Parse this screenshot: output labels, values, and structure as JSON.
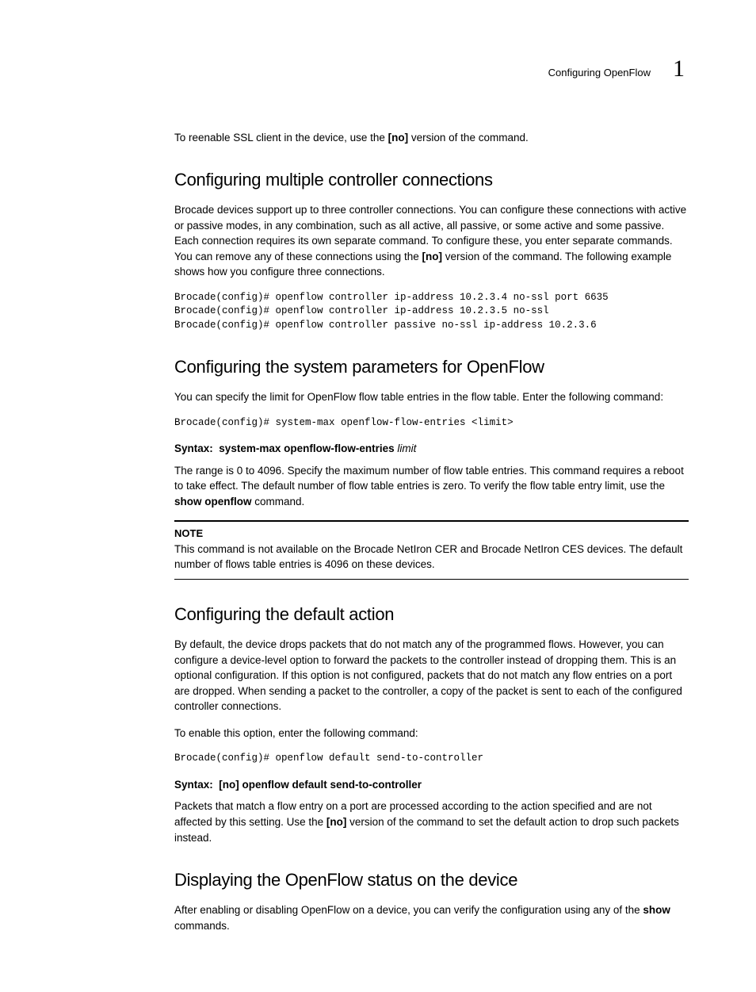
{
  "header": {
    "section": "Configuring OpenFlow",
    "chapter": "1"
  },
  "intro_p1_a": "To reenable SSL client in the device, use the ",
  "intro_p1_bold": "[no]",
  "intro_p1_b": " version of the command.",
  "sec1": {
    "title": "Configuring multiple controller connections",
    "p1a": "Brocade devices support up to three controller connections. You can configure these connections with active or passive modes, in any combination, such as all active, all passive, or some active and some passive. Each connection requires its own separate command. To configure these, you enter separate commands. You can remove any of these connections using the ",
    "p1bold": "[no]",
    "p1b": " version of the command. The following example shows how you configure three connections.",
    "code": "Brocade(config)# openflow controller ip-address 10.2.3.4 no-ssl port 6635\nBrocade(config)# openflow controller ip-address 10.2.3.5 no-ssl\nBrocade(config)# openflow controller passive no-ssl ip-address 10.2.3.6"
  },
  "sec2": {
    "title": "Configuring the system parameters for OpenFlow",
    "p1": "You can specify the limit for OpenFlow flow table entries in the flow table. Enter the following command:",
    "code": "Brocade(config)# system-max openflow-flow-entries <limit>",
    "syntax_label": "Syntax:",
    "syntax_cmd": "system-max openflow-flow-entries",
    "syntax_arg": "limit",
    "p2a": "The range is 0 to 4096. Specify the maximum number of flow table entries. This command requires a reboot to take effect. The default number of flow table entries is zero. To verify the flow table entry limit, use the ",
    "p2bold": "show openflow",
    "p2b": " command.",
    "note_hdr": "NOTE",
    "note_body": "This command is not available on the Brocade NetIron CER and Brocade NetIron CES devices. The default number of flows table entries is 4096 on these devices."
  },
  "sec3": {
    "title": "Configuring the default action",
    "p1": "By default, the device drops packets that do not match any of the programmed flows. However, you can configure a device-level option to forward the packets to the controller instead of dropping them. This is an optional configuration. If this option is not configured, packets that do not match any flow entries on a port are dropped. When sending a packet to the controller, a copy of the packet is sent to each of the configured controller connections.",
    "p2": "To enable this option, enter the following command:",
    "code": "Brocade(config)# openflow default send-to-controller",
    "syntax_label": "Syntax:",
    "syntax_cmd": "[no] openflow default send-to-controller",
    "p3a": "Packets that match a flow entry on a port are processed according to the action specified and are not affected by this setting. Use the ",
    "p3bold": "[no]",
    "p3b": " version of the command to set the default action to drop such packets instead."
  },
  "sec4": {
    "title": "Displaying the OpenFlow status on the device",
    "p1a": "After enabling or disabling OpenFlow on a device, you can verify the configuration using any of the ",
    "p1bold": "show",
    "p1b": " commands."
  }
}
